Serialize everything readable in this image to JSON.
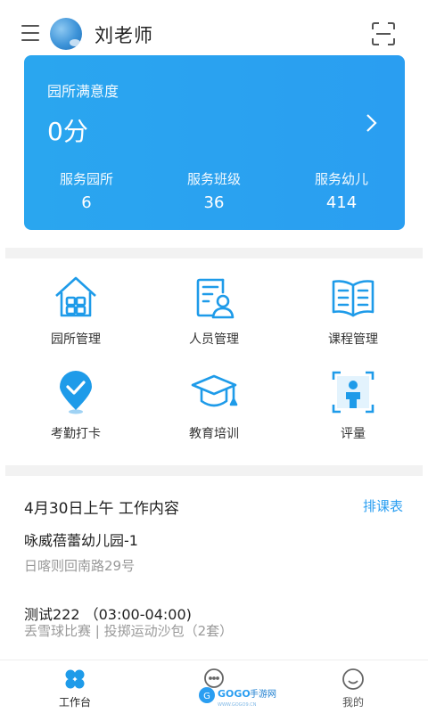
{
  "header": {
    "user_name": "刘老师",
    "menu_icon": "menu-icon",
    "scan_icon": "scan-icon"
  },
  "satisfaction_card": {
    "title": "园所满意度",
    "score": "0分",
    "stats": [
      {
        "label": "服务园所",
        "value": "6"
      },
      {
        "label": "服务班级",
        "value": "36"
      },
      {
        "label": "服务幼儿",
        "value": "414"
      }
    ]
  },
  "grid": [
    {
      "label": "园所管理",
      "icon": "kindergarten-icon"
    },
    {
      "label": "人员管理",
      "icon": "staff-icon"
    },
    {
      "label": "课程管理",
      "icon": "course-book-icon"
    },
    {
      "label": "考勤打卡",
      "icon": "location-check-icon"
    },
    {
      "label": "教育培训",
      "icon": "graduation-cap-icon"
    },
    {
      "label": "评量",
      "icon": "person-scan-icon"
    }
  ],
  "schedule": {
    "date_title": "4月30日上午  工作内容",
    "link_label": "排课表",
    "school_name": "咏威蓓蕾幼儿园-1",
    "school_address": "日喀则回南路29号",
    "event_title": "测试222 （03:00-04:00)",
    "event_desc": "丢雪球比赛 | 投掷运动沙包（2套）"
  },
  "bottom_tabs": [
    {
      "label": "工作台",
      "icon": "workbench-icon",
      "active": true
    },
    {
      "label": "",
      "icon": "chat-icon",
      "active": false
    },
    {
      "label": "我的",
      "icon": "smile-profile-icon",
      "active": false
    }
  ],
  "watermark": {
    "text": "GOGO手游网",
    "subtext": "WWW.GOGO9.CN"
  },
  "colors": {
    "accent": "#2a9ef1",
    "text": "#222222",
    "muted": "#999999"
  }
}
